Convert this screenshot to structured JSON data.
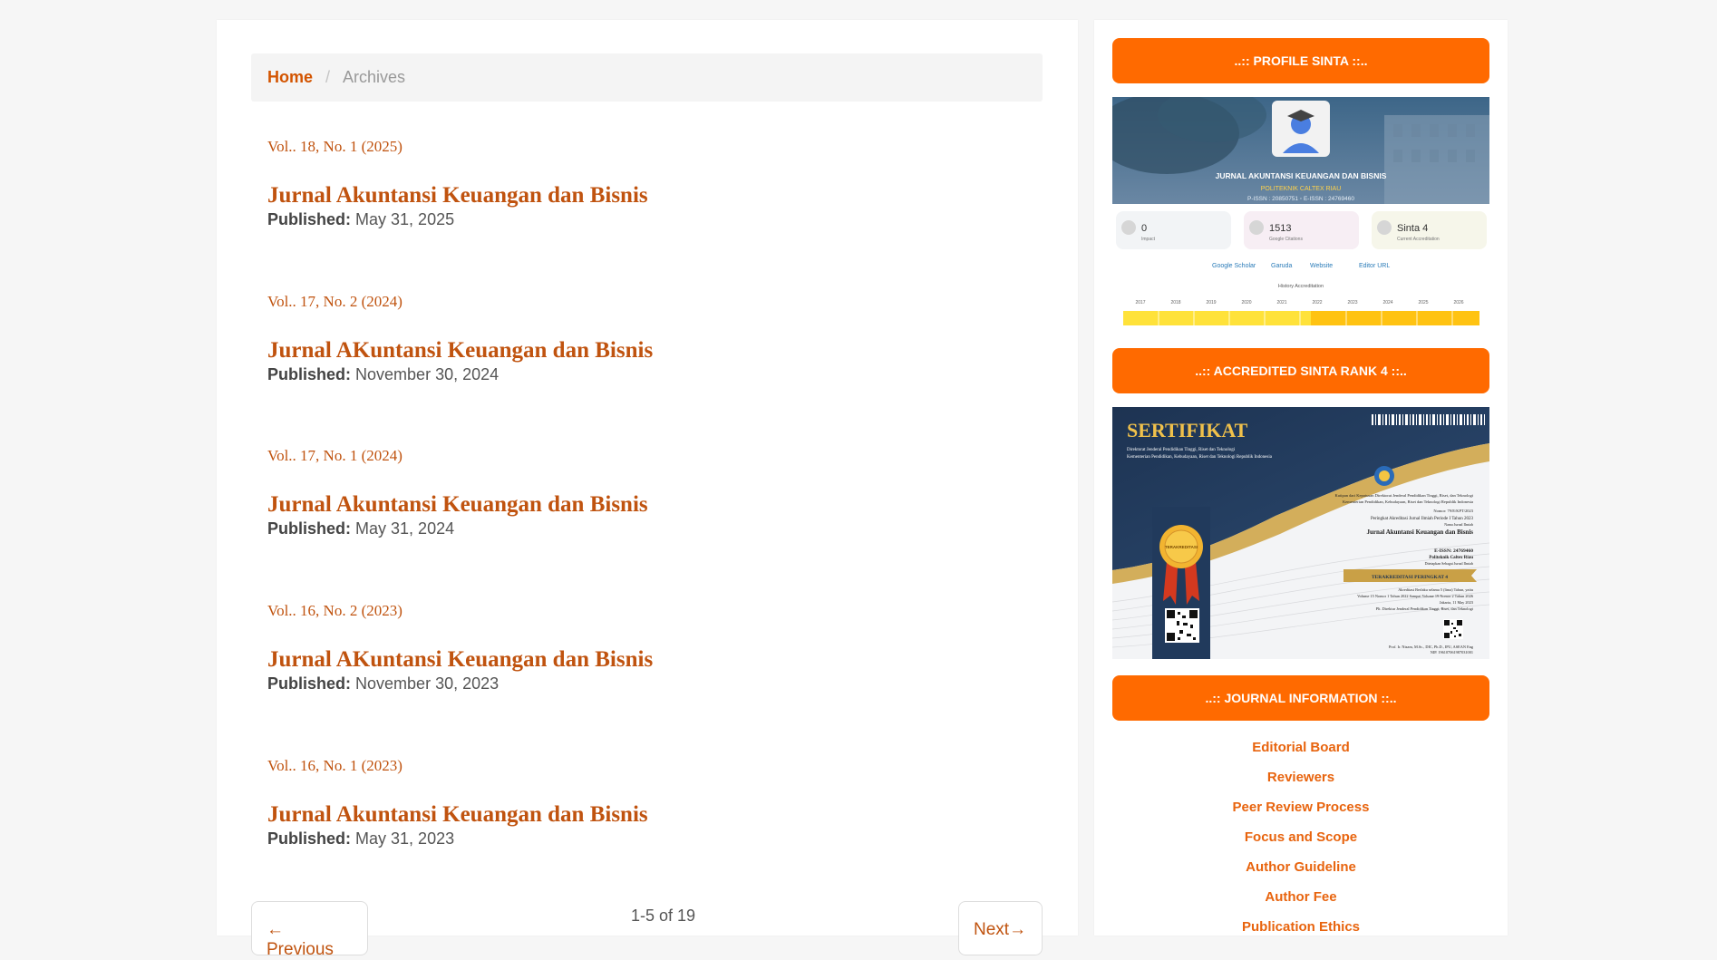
{
  "breadcrumb": {
    "home": "Home",
    "separator": "/",
    "current": "Archives"
  },
  "issues": [
    {
      "volume": "Vol.. 18, No. 1 (2025)",
      "title": "Jurnal Akuntansi Keuangan dan Bisnis",
      "published_label": "Published:",
      "date": "May 31, 2025"
    },
    {
      "volume": "Vol.. 17, No. 2 (2024)",
      "title": "Jurnal AKuntansi Keuangan dan Bisnis",
      "published_label": "Published:",
      "date": "November 30, 2024"
    },
    {
      "volume": "Vol.. 17, No. 1 (2024)",
      "title": "Jurnal Akuntansi Keuangan dan Bisnis",
      "published_label": "Published:",
      "date": "May 31, 2024"
    },
    {
      "volume": "Vol.. 16, No. 2 (2023)",
      "title": "Jurnal AKuntansi Keuangan dan Bisnis",
      "published_label": "Published:",
      "date": "November 30, 2023"
    },
    {
      "volume": "Vol.. 16, No. 1 (2023)",
      "title": "Jurnal Akuntansi Keuangan dan Bisnis",
      "published_label": "Published:",
      "date": "May 31, 2023"
    }
  ],
  "pagination": {
    "previous": "← Previous",
    "count": "1-5 of 19",
    "next": "Next→"
  },
  "sidebar": {
    "profile_heading": "..:: PROFILE SINTA ::..",
    "sinta": {
      "journal_name": "JURNAL AKUNTANSI KEUANGAN DAN BISNIS",
      "institution": "POLITEKNIK CALTEX RIAU",
      "issn": "P-ISSN : 20850751  ◦  E-ISSN : 24769460",
      "stats": [
        {
          "value": "0",
          "label": "Impact"
        },
        {
          "value": "1513",
          "label": "Google Citations"
        },
        {
          "value": "Sinta 4",
          "label": "Current Accreditation"
        }
      ],
      "links": [
        "Google Scholar",
        "Garuda",
        "Website",
        "Editor URL"
      ],
      "history_label": "History Accreditation",
      "years": [
        "2017",
        "2018",
        "2019",
        "2020",
        "2021",
        "2022",
        "2023",
        "2024",
        "2025",
        "2026"
      ]
    },
    "accredited_heading": "..:: ACCREDITED SINTA RANK 4 ::..",
    "certificate": {
      "title": "SERTIFIKAT",
      "issuer_line1": "Direktorat Jenderal Pendidikan Tinggi, Riset dan Teknologi",
      "issuer_line2": "Kementerian Pendidikan, Kebudayaan, Riset dan Teknologi Republik Indonesia",
      "decree_line1": "Kutipan dari Keputusan Direktorat Jenderal Pendidikan Tinggi, Riset, dan Teknologi",
      "decree_line2": "Kementerian Pendidikan, Kebudayaan, Riset dan Teknologi Republik Indonesia",
      "decree_number": "Nomor: 79/E/KPT/2023",
      "period": "Peringkat Akreditasi Jurnal Ilmiah Periode I Tahun 2023",
      "name_label": "Nama Jurnal Ilmiah",
      "journal": "Jurnal Akuntansi Keuangan dan Bisnis",
      "eissn": "E-ISSN: 24769460",
      "publisher": "Politeknik Caltex Riau",
      "assigned": "Ditetapkan Sebagai Jurnal Ilmiah",
      "rank_ribbon": "TERAKREDITASI PERINGKAT 4",
      "validity_line1": "Akreditasi Berlaku selama 5 (lima) Tahun, yaitu",
      "validity_line2": "Volume 15 Nomor 1 Tahun 2022 Sampai Volume 19 Nomor 2 Tahun 2026",
      "place_date": "Jakarta, 11 May 2023",
      "signer_title": "Plt. Direktur Jenderal Pendidikan Tinggi, Riset, dan Teknologi",
      "signer_name": "Prof. Ir. Nizam, M.Sc., DIC, Ph.D., IPU, ASEAN Eng",
      "signer_nip": "NIP. 196107061987031001",
      "seal_text": "TERAKREDITASI"
    },
    "info_heading": "..:: JOURNAL INFORMATION ::..",
    "info_links": [
      "Editorial Board",
      "Reviewers",
      "Peer Review Process",
      "Focus and Scope",
      "Author Guideline",
      "Author Fee",
      "Publication Ethics"
    ]
  },
  "colors": {
    "accent": "#ff6a00",
    "link": "#c0530f",
    "sidebar_link": "#e8640e"
  }
}
